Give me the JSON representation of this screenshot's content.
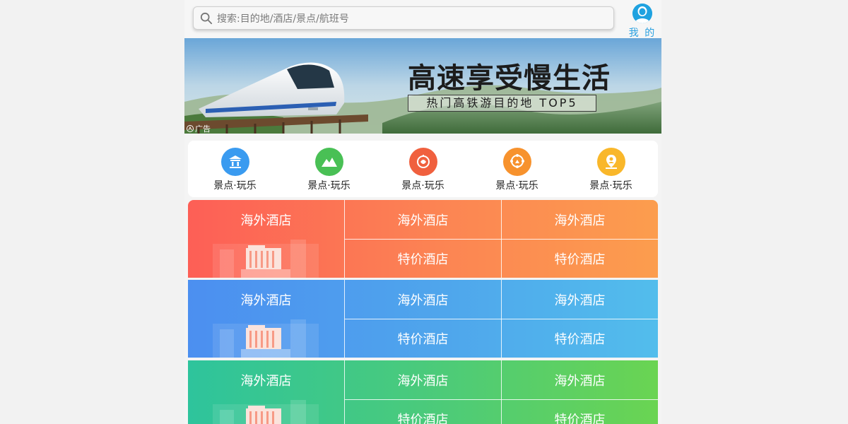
{
  "search": {
    "placeholder": "搜索:目的地/酒店/景点/航班号"
  },
  "me": {
    "label": "我 的"
  },
  "banner": {
    "title": "高速享受慢生活",
    "subtitle": "热门高铁游目的地 TOP5",
    "ad_label": "广告"
  },
  "quick_nav": [
    {
      "label": "景点·玩乐",
      "icon": "temple-icon",
      "color": "#3a9bf0"
    },
    {
      "label": "景点·玩乐",
      "icon": "mountain-icon",
      "color": "#49c055"
    },
    {
      "label": "景点·玩乐",
      "icon": "lantern-icon",
      "color": "#f0603e"
    },
    {
      "label": "景点·玩乐",
      "icon": "ferris-wheel-icon",
      "color": "#f7922d"
    },
    {
      "label": "景点·玩乐",
      "icon": "location-person-icon",
      "color": "#f9b72a"
    }
  ],
  "hotel_grids": [
    {
      "theme": "red",
      "gradient": [
        "#fd5f56",
        "#fc9d4e"
      ],
      "main": "海外酒店",
      "cells": [
        "海外酒店",
        "海外酒店",
        "特价酒店",
        "特价酒店"
      ]
    },
    {
      "theme": "blue",
      "gradient": [
        "#4c8ff0",
        "#52bdec"
      ],
      "main": "海外酒店",
      "cells": [
        "海外酒店",
        "海外酒店",
        "特价酒店",
        "特价酒店"
      ]
    },
    {
      "theme": "green",
      "gradient": [
        "#2ec49c",
        "#6ad452"
      ],
      "main": "海外酒店",
      "cells": [
        "海外酒店",
        "海外酒店",
        "特价酒店",
        "特价酒店"
      ]
    }
  ]
}
